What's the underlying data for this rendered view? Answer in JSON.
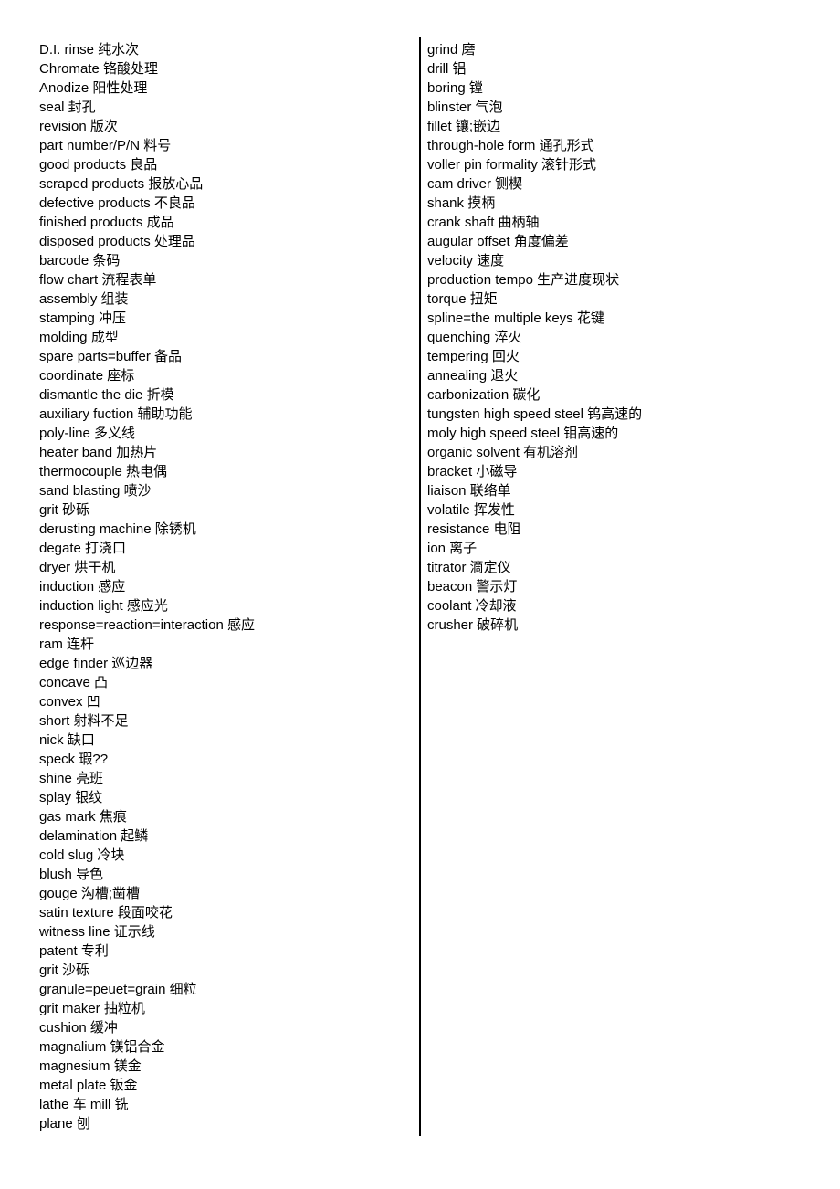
{
  "document": {
    "type": "bilingual-glossary",
    "title": "English-Chinese manufacturing terms glossary",
    "layout": "two-column",
    "divider_color": "#000000",
    "text_color": "#000000",
    "background_color": "#ffffff"
  },
  "left_column": {
    "entries": [
      "D.I. rinse 纯水次",
      "Chromate 铬酸处理",
      "Anodize 阳性处理",
      "seal 封孔",
      "revision 版次",
      "part number/P/N 料号",
      "good products 良品",
      "scraped products 报放心品",
      "defective products 不良品",
      "finished products 成品",
      "disposed products 处理品",
      "barcode 条码",
      "flow chart 流程表单",
      "assembly 组装",
      "stamping 冲压",
      "molding 成型",
      "spare parts=buffer 备品",
      "coordinate 座标",
      "dismantle the die 折模",
      "auxiliary fuction 辅助功能",
      "poly-line 多义线",
      "heater band 加热片",
      "thermocouple 热电偶",
      "sand blasting 喷沙",
      "grit 砂砾",
      "derusting machine 除锈机",
      "degate 打浇口",
      "dryer 烘干机",
      "induction 感应",
      "induction light 感应光",
      "response=reaction=interaction 感应",
      "ram 连杆",
      "edge finder 巡边器",
      "concave 凸",
      "convex 凹",
      "short 射料不足",
      "nick 缺口",
      "speck 瑕??",
      "shine 亮班",
      "splay 银纹",
      "gas mark 焦痕",
      "delamination 起鳞",
      "cold slug 冷块",
      "blush 导色",
      "gouge 沟槽;凿槽",
      "satin texture 段面咬花",
      "witness line 证示线",
      "patent 专利",
      "grit 沙砾",
      "granule=peuet=grain 细粒",
      "grit maker 抽粒机",
      "cushion 缓冲",
      "magnalium 镁铝合金",
      "magnesium 镁金",
      "metal plate 钣金",
      "lathe 车 mill 铣",
      "plane 刨"
    ]
  },
  "right_column": {
    "entries": [
      "grind 磨",
      "drill 铝",
      "boring 镗",
      "blinster 气泡",
      "fillet 镶;嵌边",
      "through-hole form 通孔形式",
      "voller pin formality 滚针形式",
      "cam driver 铡楔",
      "shank 摸柄",
      "crank shaft 曲柄轴",
      "augular offset 角度偏差",
      "velocity 速度",
      "production tempo 生产进度现状",
      "torque 扭矩",
      "spline=the multiple keys 花键",
      "quenching 淬火",
      "tempering 回火",
      "annealing 退火",
      "carbonization 碳化",
      "tungsten high speed steel 钨高速的",
      "moly high speed steel 钼高速的",
      "organic solvent 有机溶剂",
      "bracket 小磁导",
      "liaison 联络单",
      "volatile 挥发性",
      "resistance 电阻",
      "ion 离子",
      "titrator 滴定仪",
      "beacon 警示灯",
      "coolant 冷却液",
      "crusher 破碎机"
    ]
  }
}
